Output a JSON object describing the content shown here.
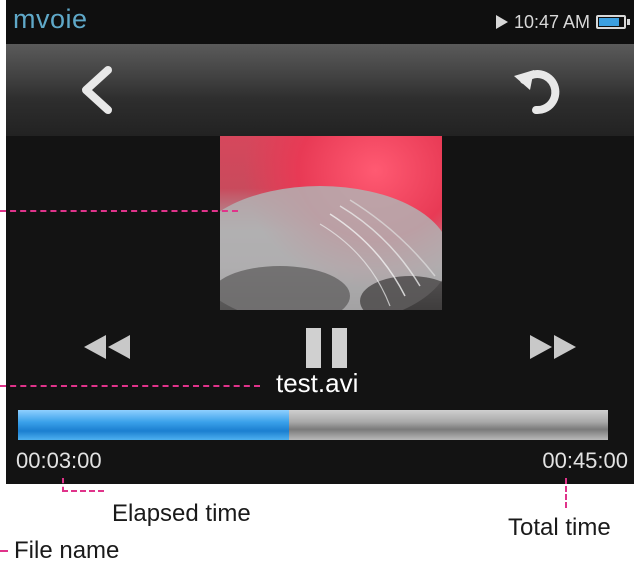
{
  "status_bar": {
    "app_title": "mvoie",
    "time": "10:47 AM",
    "battery_level": 0.85
  },
  "toolbar": {
    "back_icon": "chevron-left-icon",
    "refresh_icon": "refresh-icon"
  },
  "player": {
    "file_name": "test.avi",
    "elapsed_time": "00:03:00",
    "total_time": "00:45:00",
    "progress": 0.46
  },
  "annotations": {
    "elapsed": "Elapsed time",
    "total": "Total time",
    "file": "File name"
  },
  "colors": {
    "accent": "#5fa8c8",
    "progress": "#2f93e0",
    "annotation_line": "#e0338a"
  }
}
